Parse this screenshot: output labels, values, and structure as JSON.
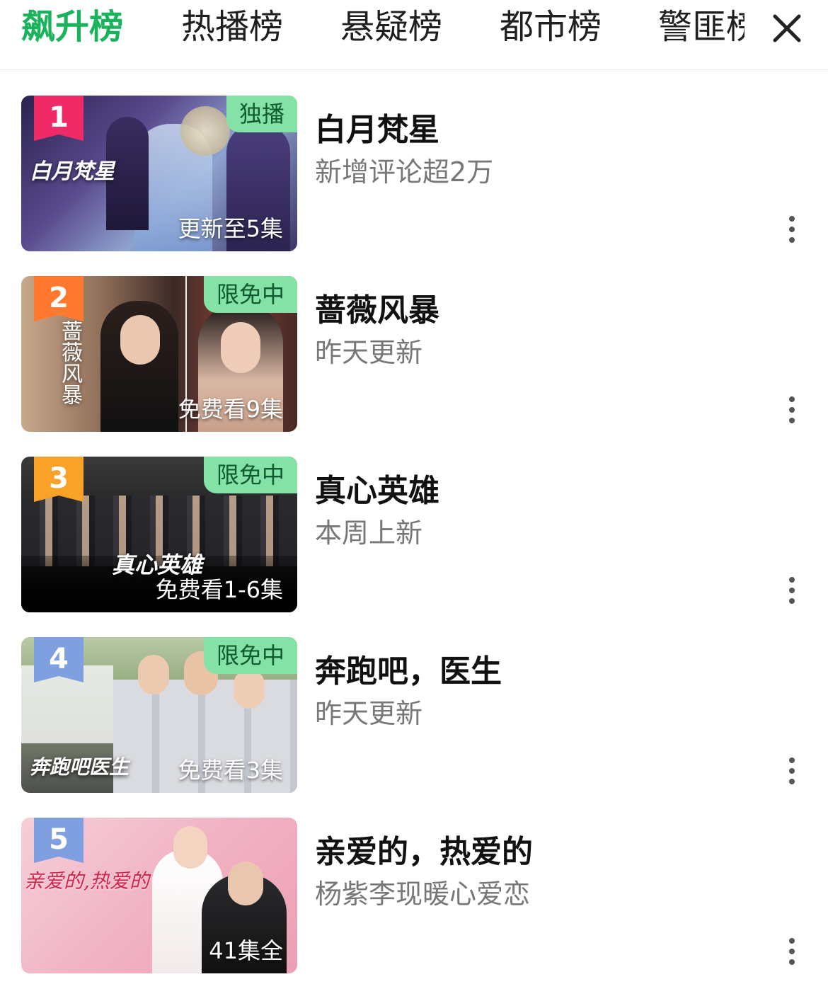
{
  "tabs": [
    {
      "label": "飙升榜",
      "active": true
    },
    {
      "label": "热播榜"
    },
    {
      "label": "悬疑榜"
    },
    {
      "label": "都市榜"
    },
    {
      "label": "警匪榜"
    }
  ],
  "close_icon": "close-icon",
  "colors": {
    "accent": "#19b35b",
    "badge_bg": "#84e2a6",
    "rank1": "#f02a67",
    "rank2": "#ff7a2e",
    "rank3": "#f8a227",
    "rank4": "#7f9fe0",
    "rank5": "#7f9fe0"
  },
  "items": [
    {
      "rank": "1",
      "badge": "独播",
      "episode": "更新至5集",
      "poster_text": "白月梵星",
      "title": "白月梵星",
      "subtitle": "新增评论超2万"
    },
    {
      "rank": "2",
      "badge": "限免中",
      "episode": "免费看9集",
      "poster_text": "蔷薇风暴",
      "title": "蔷薇风暴",
      "subtitle": "昨天更新"
    },
    {
      "rank": "3",
      "badge": "限免中",
      "episode": "免费看1-6集",
      "poster_text": "真心英雄",
      "title": "真心英雄",
      "subtitle": "本周上新"
    },
    {
      "rank": "4",
      "badge": "限免中",
      "episode": "免费看3集",
      "poster_text": "奔跑吧医生",
      "title": "奔跑吧，医生",
      "subtitle": "昨天更新"
    },
    {
      "rank": "5",
      "badge": "",
      "episode": "41集全",
      "poster_text": "亲爱的,热爱的",
      "title": "亲爱的，热爱的",
      "subtitle": "杨紫李现暖心爱恋"
    }
  ]
}
